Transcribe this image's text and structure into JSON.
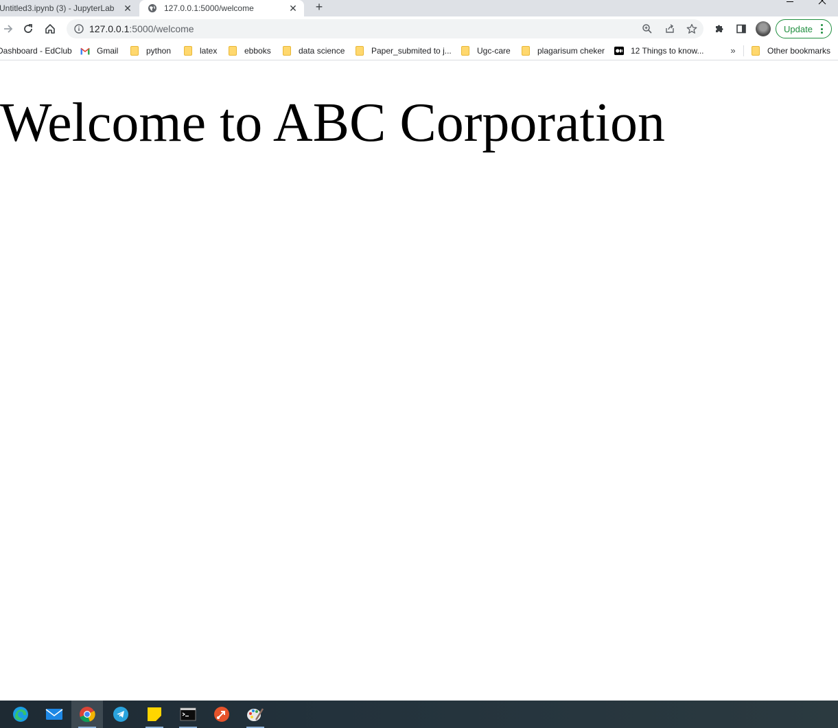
{
  "browser": {
    "tabs": [
      {
        "title": "Untitled3.ipynb (3) - JupyterLab",
        "active": false
      },
      {
        "title": "127.0.0.1:5000/welcome",
        "active": true
      }
    ],
    "address": {
      "host": "127.0.0.1",
      "rest": ":5000/welcome"
    },
    "update_label": "Update"
  },
  "bookmarks": {
    "items": [
      {
        "label": "Dashboard - EdClub",
        "icon": "edclub-icon"
      },
      {
        "label": "Gmail",
        "icon": "gmail-icon"
      },
      {
        "label": "python",
        "icon": "folder-icon"
      },
      {
        "label": "latex",
        "icon": "folder-icon"
      },
      {
        "label": "ebboks",
        "icon": "folder-icon"
      },
      {
        "label": "data science",
        "icon": "folder-icon"
      },
      {
        "label": "Paper_submited to j...",
        "icon": "folder-icon"
      },
      {
        "label": "Ugc-care",
        "icon": "folder-icon"
      },
      {
        "label": "plagarisum cheker",
        "icon": "folder-icon"
      },
      {
        "label": "12 Things to know...",
        "icon": "medium-icon"
      }
    ],
    "overflow": "»",
    "other": "Other bookmarks"
  },
  "page": {
    "heading": "Welcome to ABC Corporation"
  },
  "taskbar": {
    "apps": [
      "edge-icon",
      "mail-icon",
      "chrome-icon",
      "telegram-icon",
      "sticky-notes-icon",
      "terminal-icon",
      "git-icon",
      "paint-icon"
    ]
  },
  "colors": {
    "accent_green": "#1e8e3e",
    "tabstrip_bg": "#dee1e6",
    "omnibox_bg": "#f1f3f4"
  }
}
